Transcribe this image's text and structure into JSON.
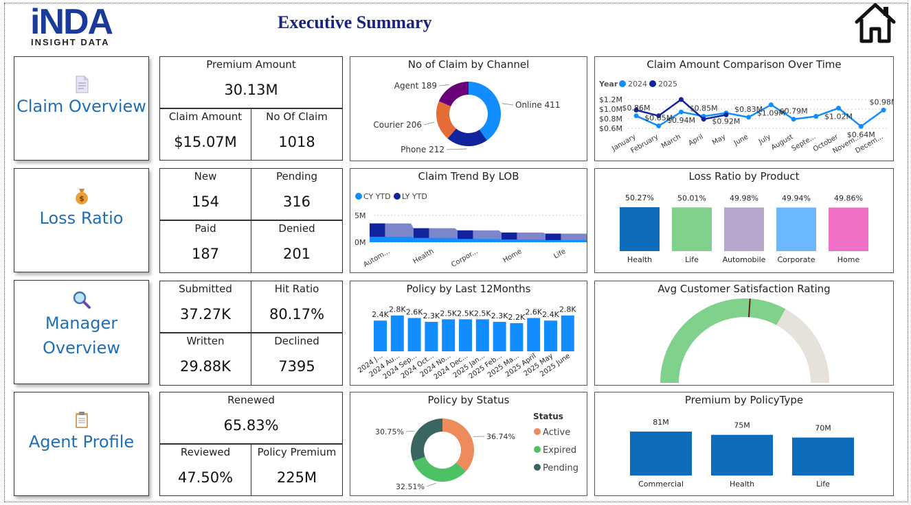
{
  "logo": {
    "main": "iNDA",
    "sub": "INSIGHT DATA"
  },
  "title": "Executive Summary",
  "nav": [
    {
      "label": "Claim Overview",
      "icon": "document-icon"
    },
    {
      "label": "Loss Ratio",
      "icon": "money-bag-icon"
    },
    {
      "label": "Manager Overview",
      "icon": "magnifier-icon"
    },
    {
      "label": "Agent Profile",
      "icon": "clipboard-icon"
    }
  ],
  "kpi": {
    "premium_amount": {
      "label": "Premium Amount",
      "value": "30.13M"
    },
    "claim_amount": {
      "label": "Claim Amount",
      "value": "$15.07M"
    },
    "no_of_claim": {
      "label": "No Of Claim",
      "value": "1018"
    },
    "new": {
      "label": "New",
      "value": "154"
    },
    "pending": {
      "label": "Pending",
      "value": "316"
    },
    "paid": {
      "label": "Paid",
      "value": "187"
    },
    "denied": {
      "label": "Denied",
      "value": "201"
    },
    "submitted": {
      "label": "Submitted",
      "value": "37.27K"
    },
    "hit_ratio": {
      "label": "Hit Ratio",
      "value": "80.17%"
    },
    "written": {
      "label": "Written",
      "value": "29.88K"
    },
    "declined": {
      "label": "Declined",
      "value": "7395"
    },
    "renewed": {
      "label": "Renewed",
      "value": "65.83%"
    },
    "reviewed": {
      "label": "Reviewed",
      "value": "47.50%"
    },
    "policy_premium": {
      "label": "Policy Premium",
      "value": "225M"
    }
  },
  "colors": {
    "nav_text": "#1f6fb6",
    "title": "#1a237e",
    "blue_bright": "#118dff",
    "navy": "#12239e",
    "orange": "#e66c37",
    "purple": "#6b007b",
    "bar_dark": "#0f6cbd"
  },
  "chart_data": [
    {
      "id": "claims_by_channel",
      "type": "pie",
      "title": "No of Claim by Channel",
      "categories": [
        "Online",
        "Phone",
        "Courier",
        "Agent"
      ],
      "values": [
        411,
        212,
        206,
        189
      ],
      "labels": [
        "Online 411",
        "Phone 212",
        "Courier 206",
        "Agent 189"
      ],
      "colors": [
        "#118dff",
        "#12239e",
        "#e66c37",
        "#6b007b"
      ]
    },
    {
      "id": "claim_amount_over_time",
      "type": "line",
      "title": "Claim Amount Comparison Over Time",
      "legend_title": "Year",
      "categories": [
        "January",
        "February",
        "March",
        "April",
        "May",
        "June",
        "July",
        "August",
        "Septe...",
        "October",
        "Novem...",
        "Decem..."
      ],
      "series": [
        {
          "name": "2024",
          "color": "#118dff",
          "values": [
            0.86,
            0.65,
            0.94,
            0.85,
            0.92,
            0.83,
            1.09,
            0.79,
            0.85,
            1.02,
            0.64,
            0.98
          ]
        },
        {
          "name": "2025",
          "color": "#12239e",
          "values": [
            0.98,
            0.86,
            1.2,
            0.79,
            0.88,
            null,
            null,
            null,
            null,
            null,
            null,
            null
          ]
        }
      ],
      "point_labels": [
        "$0.86M",
        "$0.65M",
        "$0.94M",
        "$0.85M",
        "$0.92M",
        "$0.83M",
        "$1.09M",
        "$0.79M",
        "",
        "$1.02M",
        "$0.64M",
        "$0.98M"
      ],
      "yticks": [
        "$1.2M",
        "$1.0M",
        "$0.8M",
        "$0.6M"
      ],
      "ylim": [
        0.6,
        1.2
      ],
      "legend": "top-left"
    },
    {
      "id": "claim_trend_by_lob",
      "type": "area",
      "title": "Claim Trend By LOB",
      "categories": [
        "Autom...",
        "Health",
        "Corpor...",
        "Home",
        "Life"
      ],
      "series": [
        {
          "name": "CY YTD",
          "color": "#118dff",
          "values": [
            1.0,
            0.8,
            0.6,
            0.5,
            0.4
          ]
        },
        {
          "name": "LY YTD",
          "color": "#12239e",
          "values": [
            3.5,
            2.6,
            2.2,
            1.8,
            1.6
          ]
        }
      ],
      "yticks": [
        "5M",
        "0M"
      ],
      "ylim": [
        0,
        6
      ],
      "legend": "top-left"
    },
    {
      "id": "loss_ratio_by_product",
      "type": "bar",
      "title": "Loss Ratio by Product",
      "categories": [
        "Health",
        "Life",
        "Automobile",
        "Corporate",
        "Home"
      ],
      "values": [
        50.27,
        50.01,
        49.98,
        49.94,
        49.86
      ],
      "labels": [
        "50.27%",
        "50.01%",
        "49.98%",
        "49.94%",
        "49.86%"
      ],
      "colors": [
        "#0f6cbd",
        "#7fd18c",
        "#b5a8cc",
        "#6bb8ff",
        "#ee6fc5"
      ]
    },
    {
      "id": "policy_last_12_months",
      "type": "bar",
      "title": "Policy by Last 12Months",
      "categories": [
        "2024 J...",
        "2024 Au...",
        "2024 Sep...",
        "2024 Oct...",
        "2024 No...",
        "2024 Dec...",
        "2025 Jan...",
        "2025 Feb...",
        "2025 Ma...",
        "2025 April",
        "2025 May",
        "2025 June"
      ],
      "values": [
        2.4,
        2.8,
        2.6,
        2.3,
        2.5,
        2.5,
        2.5,
        2.3,
        2.2,
        2.6,
        2.4,
        2.8
      ],
      "labels": [
        "2.4K",
        "2.8K",
        "2.6K",
        "2.3K",
        "2.5K",
        "2.5K",
        "2.5K",
        "2.3K",
        "2.2K",
        "2.6K",
        "2.4K",
        "2.8K"
      ],
      "ylim": [
        0,
        3
      ],
      "color": "#118dff"
    },
    {
      "id": "avg_customer_satisfaction",
      "type": "gauge",
      "title": "Avg Customer Satisfaction Rating",
      "fill_fraction": 0.66,
      "target_fraction": 0.52,
      "colors": [
        "#7fd18c",
        "#e6e1da",
        "#6b1a1a"
      ]
    },
    {
      "id": "policy_by_status",
      "type": "pie",
      "title": "Policy by Status",
      "legend_title": "Status",
      "categories": [
        "Active",
        "Expired",
        "Pending"
      ],
      "values": [
        36.74,
        32.51,
        30.75
      ],
      "labels": [
        "36.74%",
        "32.51%",
        "30.75%"
      ],
      "colors": [
        "#ee8b5b",
        "#4cc265",
        "#3a6661"
      ],
      "legend": "right"
    },
    {
      "id": "premium_by_policytype",
      "type": "bar",
      "title": "Premium by PolicyType",
      "categories": [
        "Commercial",
        "Health",
        "Life"
      ],
      "values": [
        81,
        75,
        70
      ],
      "labels": [
        "81M",
        "75M",
        "70M"
      ],
      "ylim": [
        0,
        90
      ],
      "color": "#0f6cbd"
    }
  ]
}
